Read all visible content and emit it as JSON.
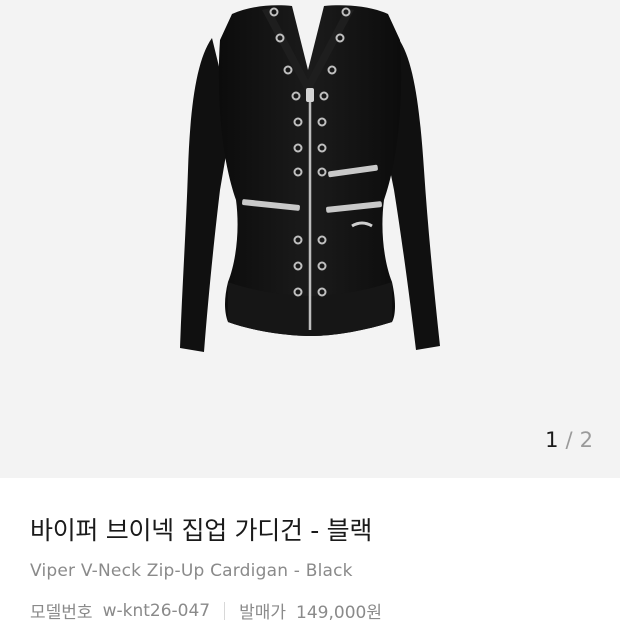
{
  "gallery": {
    "image_icon": "product-photo-black-zip-cardigan",
    "counter": {
      "current": "1",
      "separator": "/",
      "total": "2"
    }
  },
  "product": {
    "title_ko": "바이퍼 브이넥 집업 가디건 - 블랙",
    "title_en": "Viper V-Neck Zip-Up Cardigan - Black",
    "model_label": "모델번호",
    "model_number": "w-knt26-047",
    "price_label": "발매가",
    "price": "149,000원"
  },
  "colors": {
    "gallery_bg": "#f3f3f3",
    "garment": "#111111",
    "hardware": "#c9c9c9"
  }
}
